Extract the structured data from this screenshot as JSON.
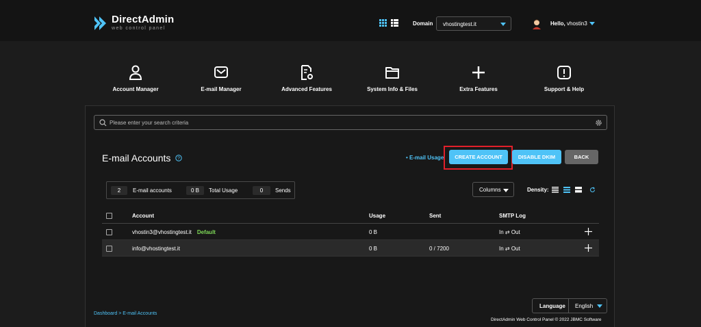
{
  "brand": {
    "name": "DirectAdmin",
    "tagline": "web control panel",
    "accent": "#4fc3f7"
  },
  "header": {
    "domain_label": "Domain",
    "domain_value": "vhostingtest.it",
    "greeting": "Hello,",
    "username": "vhostin3"
  },
  "nav": [
    {
      "label": "Account Manager",
      "icon": "user-icon"
    },
    {
      "label": "E-mail Manager",
      "icon": "envelope-icon"
    },
    {
      "label": "Advanced Features",
      "icon": "settings-file-icon"
    },
    {
      "label": "System Info & Files",
      "icon": "folder-icon"
    },
    {
      "label": "Extra Features",
      "icon": "plus-icon"
    },
    {
      "label": "Support & Help",
      "icon": "alert-icon"
    }
  ],
  "search": {
    "placeholder": "Please enter your search criteria"
  },
  "page": {
    "title": "E-mail Accounts",
    "email_usage_link": "• E-mail Usage",
    "create_account": "CREATE ACCOUNT",
    "disable_dkim": "DISABLE DKIM",
    "back": "BACK"
  },
  "stats": {
    "accounts_count": "2",
    "accounts_label": "E-mail accounts",
    "usage_value": "0 B",
    "usage_label": "Total Usage",
    "sends_value": "0",
    "sends_label": "Sends"
  },
  "toolbar": {
    "columns": "Columns",
    "density": "Density:"
  },
  "table": {
    "headers": [
      "Account",
      "Usage",
      "Sent",
      "SMTP Log"
    ],
    "rows": [
      {
        "account": "vhostin3@vhostingtest.it",
        "badge": "Default",
        "usage": "0 B",
        "sent": "",
        "smtp": "In ⇄ Out"
      },
      {
        "account": "info@vhostingtest.it",
        "badge": "",
        "usage": "0 B",
        "sent": "0 / 7200",
        "smtp": "In ⇄ Out"
      }
    ]
  },
  "breadcrumb": {
    "home": "Dashboard",
    "sep": " > ",
    "current": "E-mail Accounts"
  },
  "language": {
    "label": "Language",
    "value": "English"
  },
  "footer": "DirectAdmin Web Control Panel © 2022 JBMC Software"
}
